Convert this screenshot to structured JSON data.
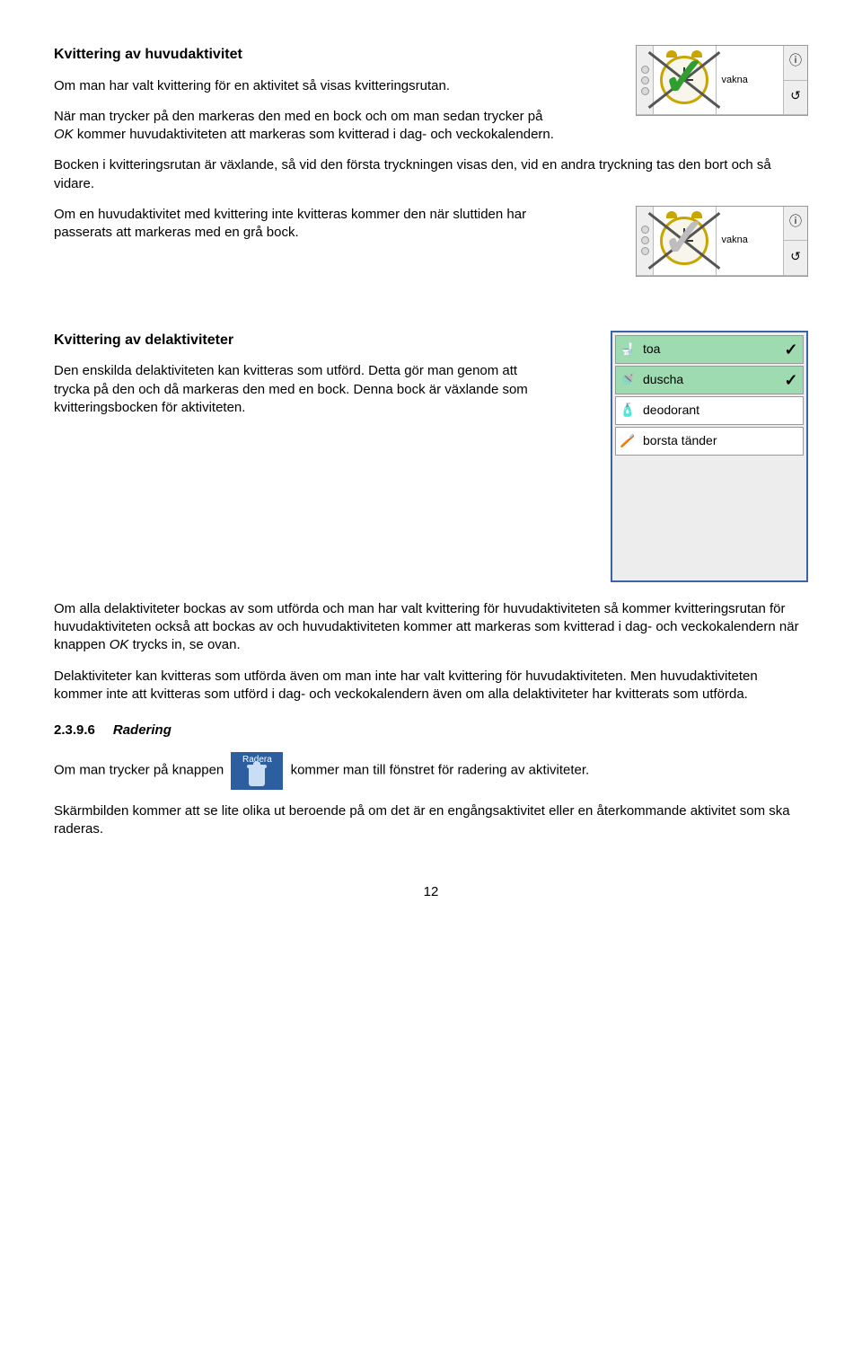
{
  "section1": {
    "heading": "Kvittering av huvudaktivitet",
    "p1": "Om man har valt kvittering för en aktivitet så visas kvitteringsrutan.",
    "p2_a": "När man trycker på den markeras den med en bock och om man sedan trycker på ",
    "p2_ok": "OK",
    "p2_b": " kommer huvudaktiviteten att markeras som kvitterad i dag- och veckokalendern.",
    "p3": "Bocken i kvitteringsrutan är växlande, så vid den första tryckningen visas den, vid en andra tryckning tas den bort och så vidare.",
    "p4": "Om en huvudaktivitet med kvittering inte kvitteras kommer den när sluttiden har passerats att markeras med en grå bock."
  },
  "alarm": {
    "label": "vakna",
    "info_icon": "ⓘ",
    "swap_icon": "↺"
  },
  "section2": {
    "heading": "Kvittering av delaktiviteter",
    "p1": "Den enskilda delaktiviteten kan kvitteras som utförd. Detta gör man genom att trycka på den och då markeras den med en bock. Denna bock är växlande som kvitteringsbocken för aktiviteten."
  },
  "checklist": {
    "items": [
      {
        "label": "toa",
        "done": true,
        "icon": "🚽"
      },
      {
        "label": "duscha",
        "done": true,
        "icon": "🚿"
      },
      {
        "label": "deodorant",
        "done": false,
        "icon": "🧴"
      },
      {
        "label": "borsta tänder",
        "done": false,
        "icon": "🪥"
      }
    ],
    "tick": "✓"
  },
  "section3": {
    "p1_a": "Om alla delaktiviteter bockas av som utförda och man har valt kvittering för huvudaktiviteten så kommer kvitteringsrutan för huvudaktiviteten också att bockas av och huvudaktiviteten kommer att markeras som kvitterad i dag- och veckokalendern när knappen ",
    "p1_ok": "OK",
    "p1_b": " trycks in, se ovan.",
    "p2": "Delaktiviteter kan kvitteras som utförda även om man inte har valt kvittering för huvudaktiviteten. Men huvudaktiviteten kommer inte att kvitteras som utförd i dag- och veckokalendern även om alla delaktiviteter har kvitterats som utförda."
  },
  "section4": {
    "num": "2.3.9.6",
    "title": "Radering",
    "radera_label": "Radera",
    "p1_a": "Om man trycker på knappen ",
    "p1_b": " kommer man till fönstret för radering av aktiviteter.",
    "p2": "Skärmbilden kommer att se lite olika ut beroende på om det är en engångsaktivitet eller en återkommande aktivitet som ska raderas."
  },
  "page": "12"
}
